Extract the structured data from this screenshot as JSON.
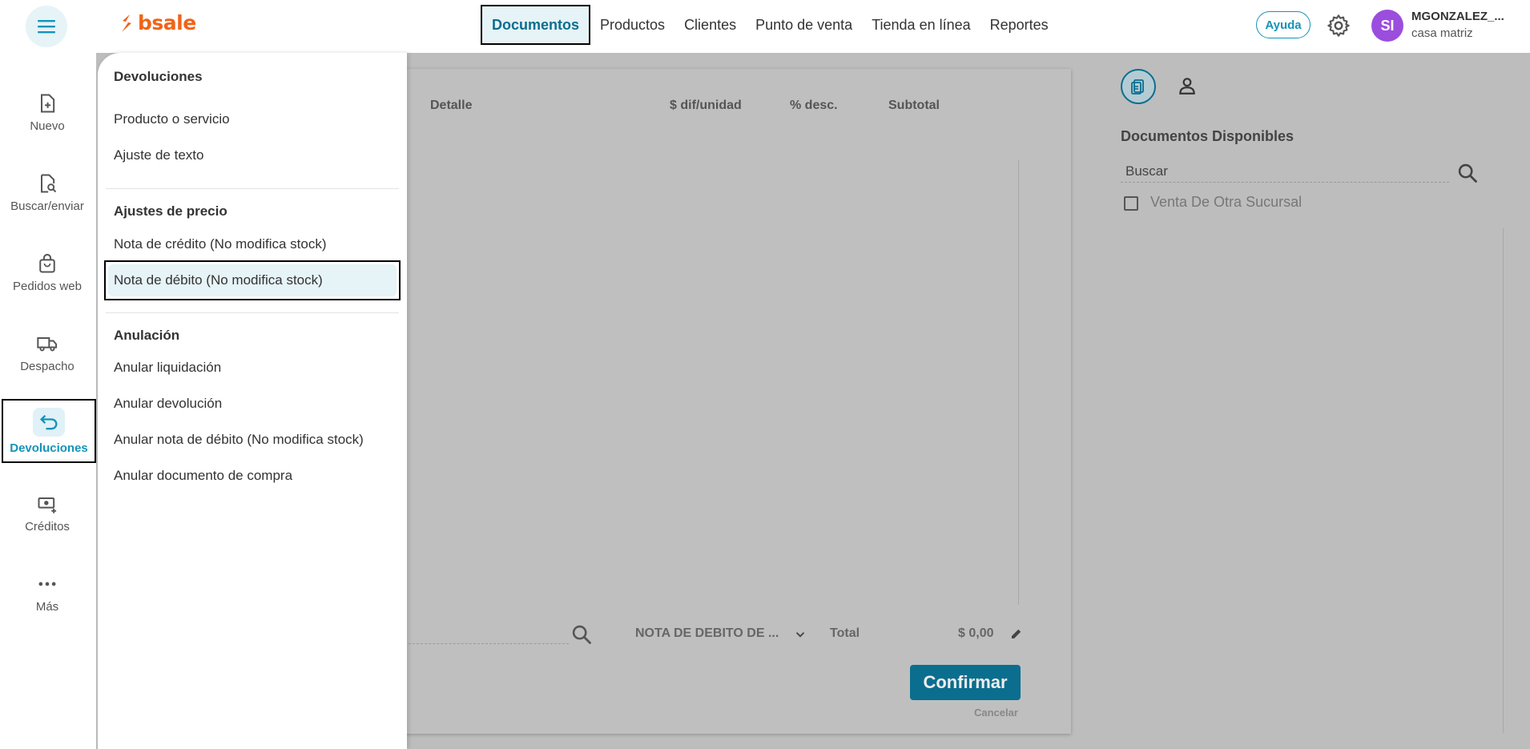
{
  "header": {
    "logo": "bsale",
    "nav": [
      "Documentos",
      "Productos",
      "Clientes",
      "Punto de venta",
      "Tienda en línea",
      "Reportes"
    ],
    "help_label": "Ayuda",
    "avatar_initials": "SI",
    "user_name": "MGONZALEZ_...",
    "user_branch": "casa matriz"
  },
  "sidebar": {
    "items": [
      {
        "label": "Nuevo",
        "icon": "new-document-icon"
      },
      {
        "label": "Buscar/enviar",
        "icon": "search-document-icon"
      },
      {
        "label": "Pedidos web",
        "icon": "shopping-bag-icon"
      },
      {
        "label": "Despacho",
        "icon": "truck-icon"
      },
      {
        "label": "Devoluciones",
        "icon": "return-arrow-icon",
        "active": true
      },
      {
        "label": "Créditos",
        "icon": "money-icon"
      },
      {
        "label": "Más",
        "icon": "more-dots-icon"
      }
    ]
  },
  "menu": {
    "sections": [
      {
        "title": "Devoluciones",
        "items": [
          "Producto o servicio",
          "Ajuste de texto"
        ]
      },
      {
        "title": "Ajustes de precio",
        "items": [
          "Nota de crédito (No modifica stock)",
          "Nota de débito (No modifica stock)"
        ]
      },
      {
        "title": "Anulación",
        "items": [
          "Anular liquidación",
          "Anular devolución",
          "Anular nota de débito (No modifica stock)",
          "Anular documento de compra"
        ]
      }
    ],
    "active_item": "Nota de débito (No modifica stock)"
  },
  "document": {
    "columns": [
      "Detalle",
      "$ dif/unidad",
      "% desc.",
      "Subtotal"
    ],
    "doc_type": "NOTA DE DEBITO DE ...",
    "total_label": "Total",
    "total_value": "$ 0,00",
    "confirm_label": "Confirmar",
    "cancel_label": "Cancelar"
  },
  "right_panel": {
    "title": "Documentos Disponibles",
    "search_placeholder": "Buscar",
    "checkbox_label": "Venta De Otra Sucursal"
  },
  "colors": {
    "brand": "#f06418",
    "accent": "#0b6e8e",
    "highlight": "#e6f3f7",
    "avatar": "#9b4dde"
  }
}
